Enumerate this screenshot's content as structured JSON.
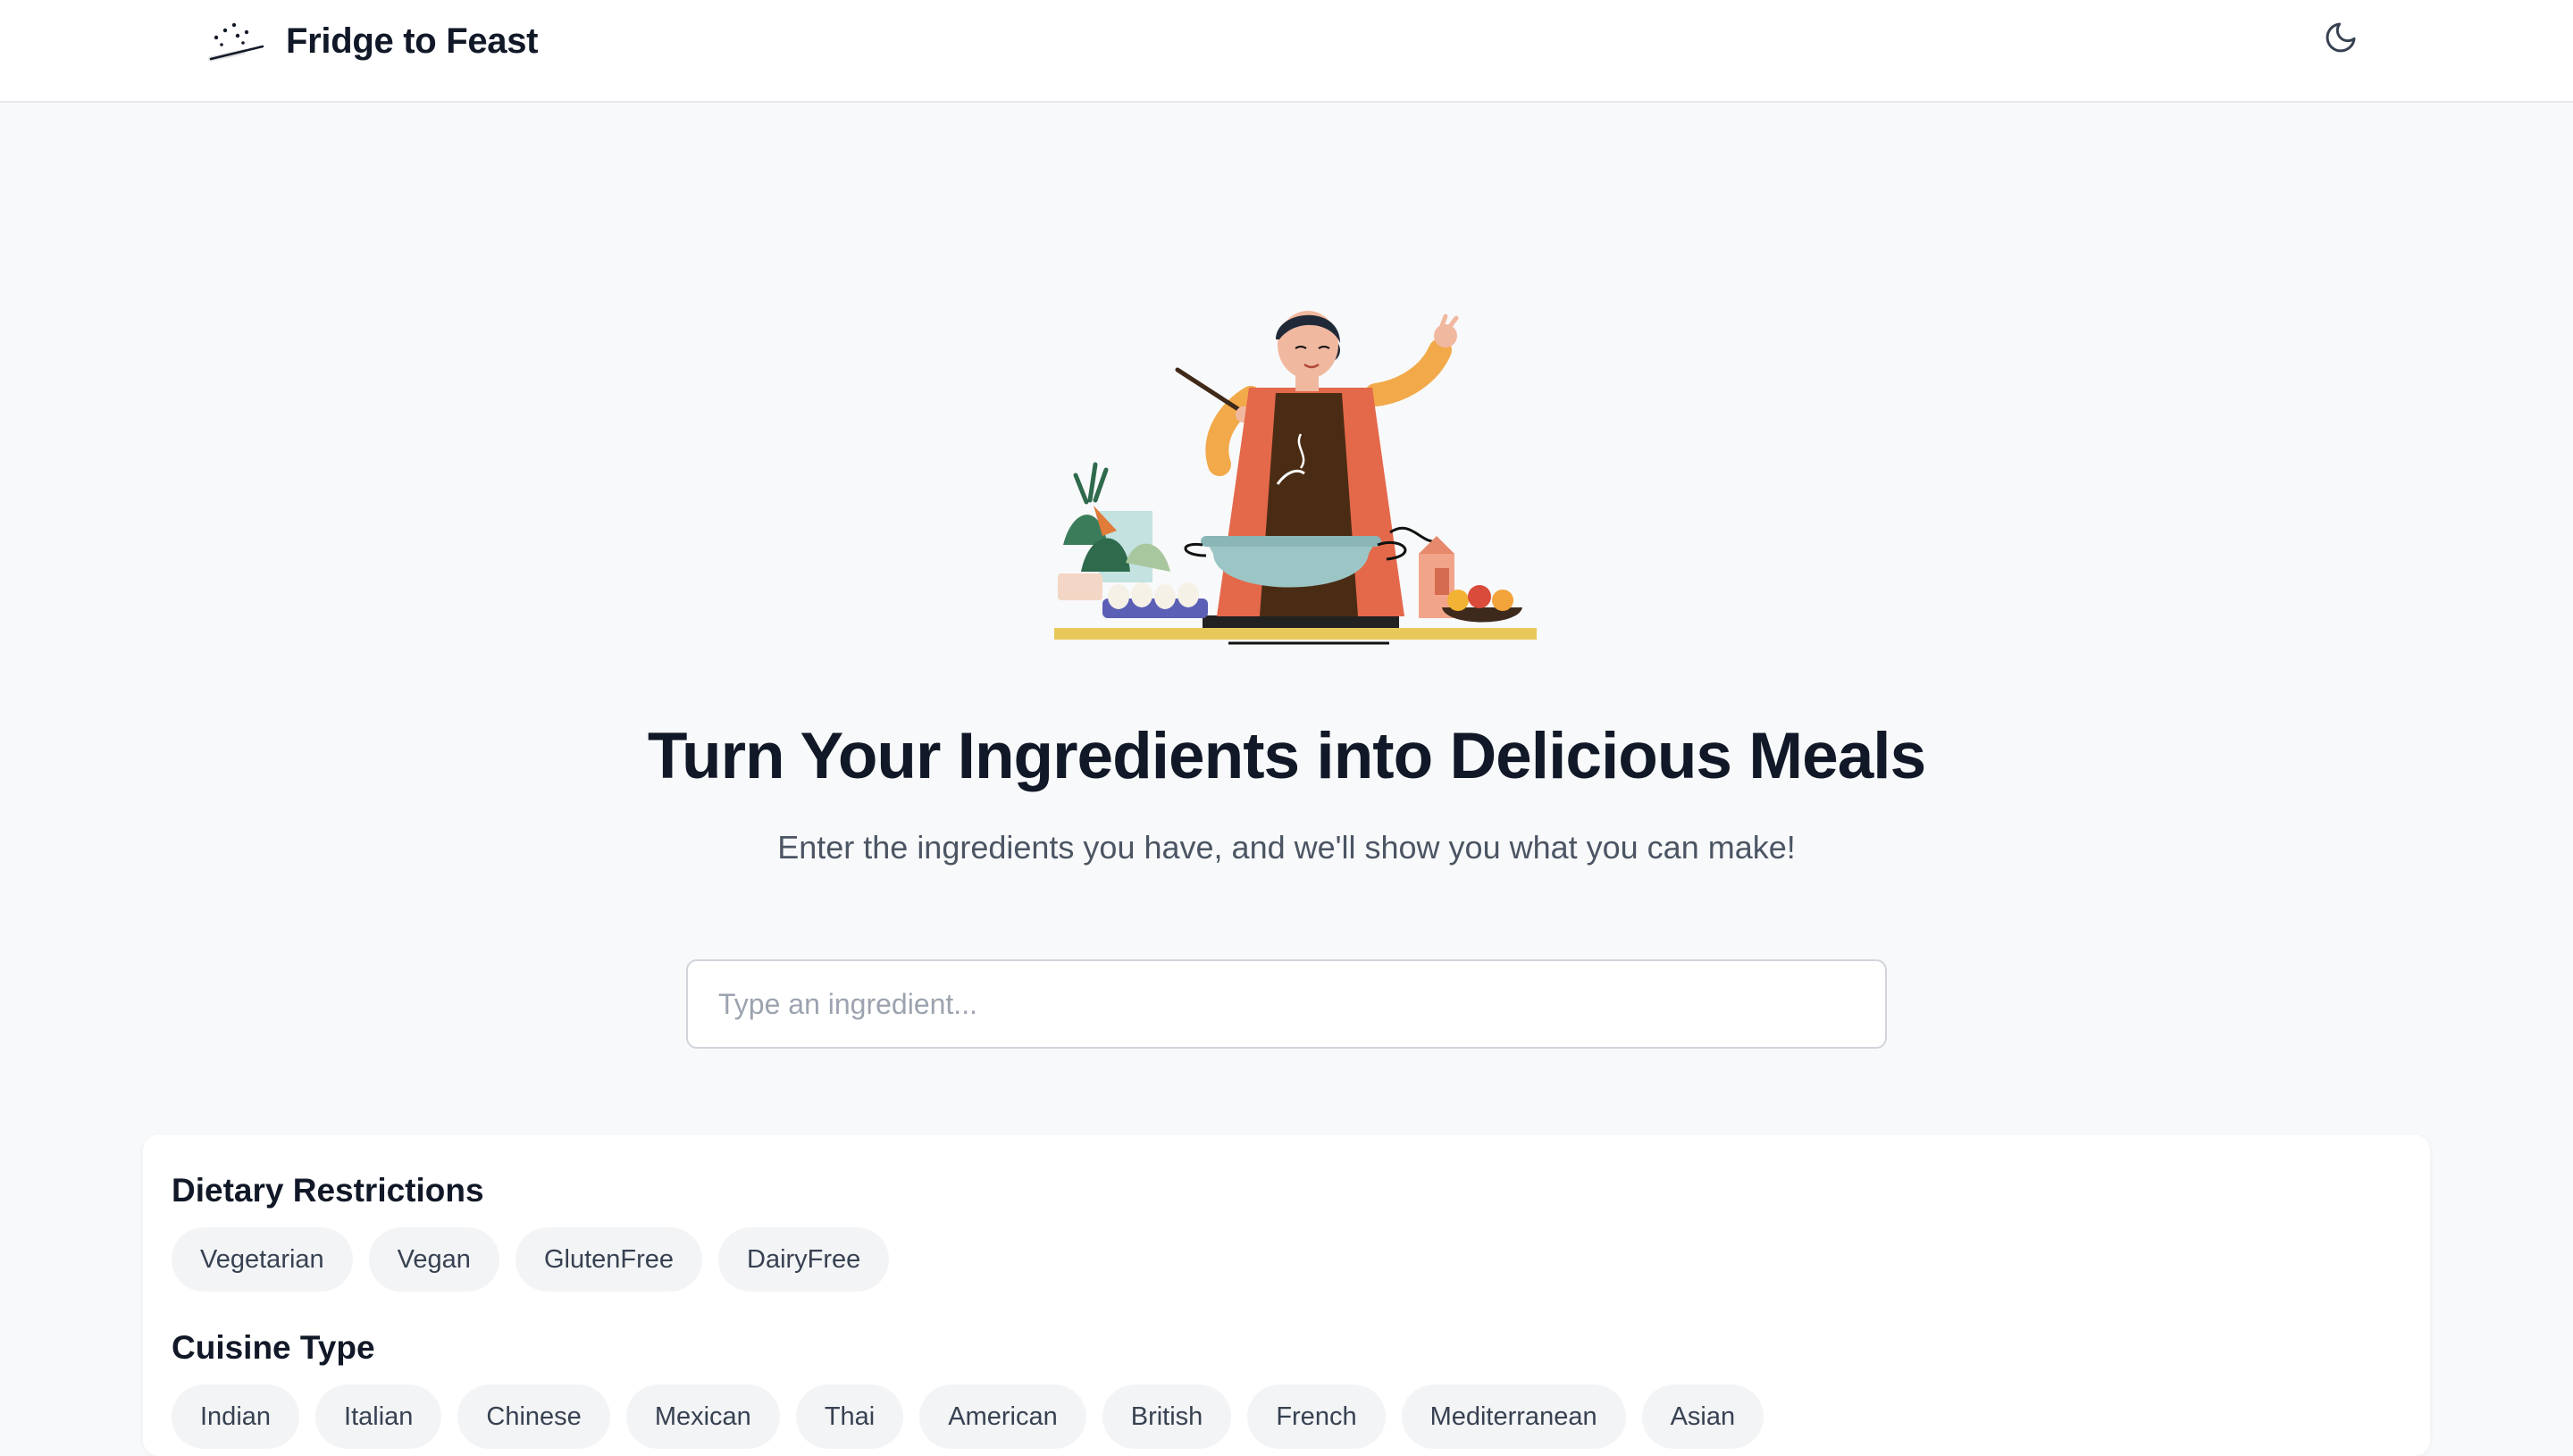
{
  "navbar": {
    "brand_name": "Fridge to Feast",
    "brand_icon": "magic-wand-icon",
    "theme_toggle_icon": "moon-icon"
  },
  "hero": {
    "illustration": "chef-cooking-illustration",
    "title": "Turn Your Ingredients into Delicious Meals",
    "subtitle": "Enter the ingredients you have, and we'll show you what you can make!"
  },
  "search": {
    "placeholder": "Type an ingredient...",
    "value": ""
  },
  "filters": {
    "dietary": {
      "title": "Dietary Restrictions",
      "options": [
        "Vegetarian",
        "Vegan",
        "GlutenFree",
        "DairyFree"
      ]
    },
    "cuisine": {
      "title": "Cuisine Type",
      "options": [
        "Indian",
        "Italian",
        "Chinese",
        "Mexican",
        "Thai",
        "American",
        "British",
        "French",
        "Mediterranean",
        "Asian"
      ]
    }
  },
  "colors": {
    "background": "#f8f9fa",
    "text_primary": "#111827",
    "text_secondary": "#4b5563",
    "chip_background": "#f3f4f6"
  }
}
